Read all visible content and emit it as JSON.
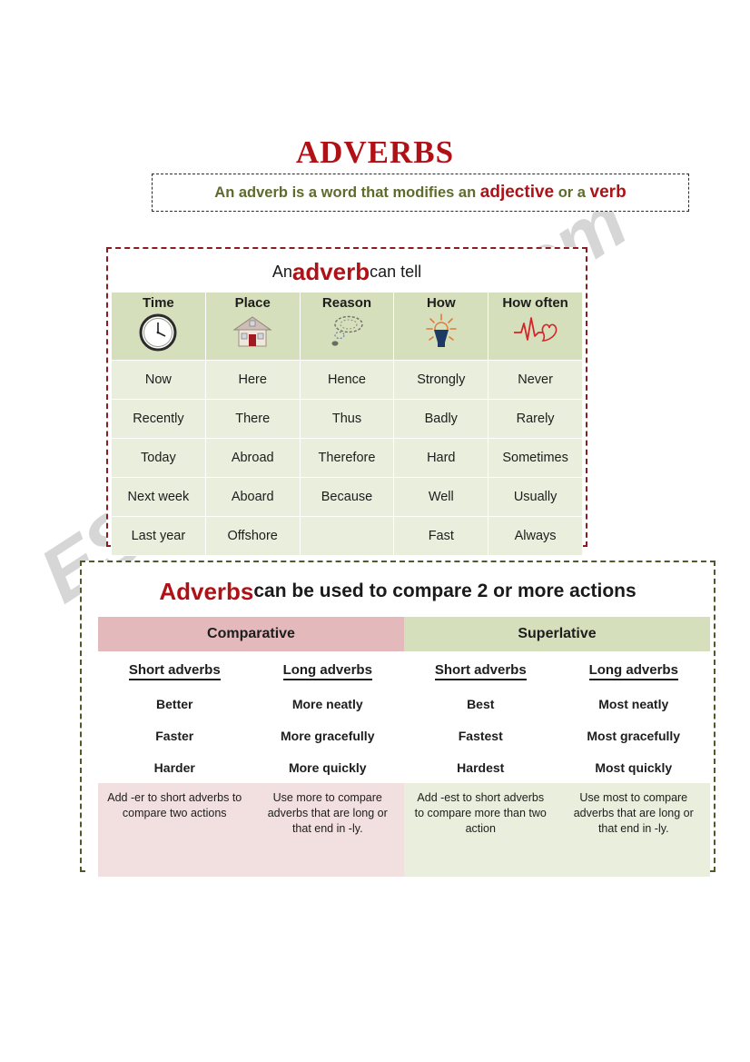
{
  "title": "ADVERBS",
  "definition": {
    "part1": "An adverb is a word that modifies an ",
    "highlight1": "adjective",
    "part2": " or a ",
    "highlight2": "verb"
  },
  "watermark": "ESLprintables.com",
  "section_one": {
    "heading_lead": "An",
    "heading_word": "adverb",
    "heading_tail": "can tell",
    "columns": [
      {
        "label": "Time",
        "icon": "clock-icon"
      },
      {
        "label": "Place",
        "icon": "house-icon"
      },
      {
        "label": "Reason",
        "icon": "thought-bubble-icon"
      },
      {
        "label": "How",
        "icon": "lightbulb-icon"
      },
      {
        "label": "How often",
        "icon": "heartbeat-icon"
      }
    ],
    "rows": [
      [
        "Now",
        "Here",
        "Hence",
        "Strongly",
        "Never"
      ],
      [
        "Recently",
        "There",
        "Thus",
        "Badly",
        "Rarely"
      ],
      [
        "Today",
        "Abroad",
        "Therefore",
        "Hard",
        "Sometimes"
      ],
      [
        "Next week",
        "Aboard",
        "Because",
        "Well",
        "Usually"
      ],
      [
        "Last year",
        "Offshore",
        "",
        "Fast",
        "Always"
      ]
    ]
  },
  "section_two": {
    "heading_word": "Adverbs",
    "heading_tail": "can be used to compare 2 or more actions",
    "degrees": [
      {
        "label": "Comparative"
      },
      {
        "label": "Superlative"
      }
    ],
    "sub_headers": [
      "Short adverbs",
      "Long adverbs",
      "Short adverbs",
      "Long adverbs"
    ],
    "rows": [
      [
        "Better",
        "More neatly",
        "Best",
        "Most neatly"
      ],
      [
        "Faster",
        "More gracefully",
        "Fastest",
        "Most gracefully"
      ],
      [
        "Harder",
        "More quickly",
        "Hardest",
        "Most quickly"
      ]
    ],
    "notes": [
      "Add -er to short adverbs to compare two actions",
      "Use more  to compare adverbs that are long or that end in -ly.",
      "Add -est to short adverbs to compare more than two action",
      "Use most to compare adverbs that are long or that end in -ly."
    ]
  },
  "colors": {
    "title_red": "#b01116",
    "definition_green": "#5e6b2d",
    "header_green": "#d6dfbc",
    "body_green": "#eaeedd",
    "comparative_pink": "#e3b9bc",
    "note_pink": "#f2dfdf",
    "section_one_border": "#8b1c22",
    "section_two_border": "#4f5a2b"
  }
}
